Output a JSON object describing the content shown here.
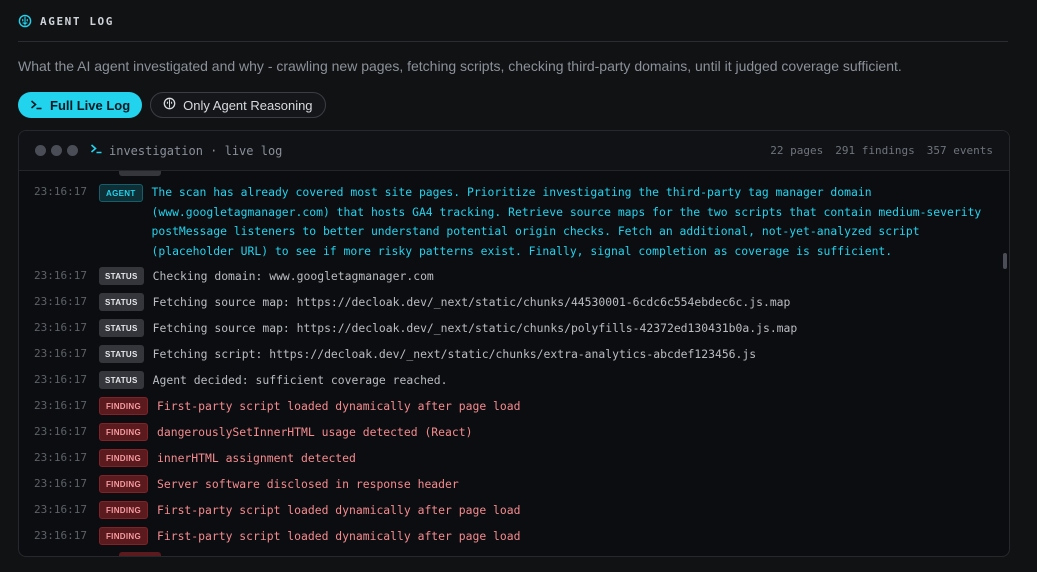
{
  "header": {
    "title": "AGENT LOG",
    "description": "What the AI agent investigated and why - crawling new pages, fetching scripts, checking third-party domains, until it judged coverage sufficient."
  },
  "tabs": [
    {
      "label": "Full Live Log",
      "icon": "terminal-prompt-icon",
      "active": true
    },
    {
      "label": "Only Agent Reasoning",
      "icon": "brain-icon",
      "active": false
    }
  ],
  "terminal": {
    "title": "investigation · live log",
    "stats": {
      "pages": "22 pages",
      "findings": "291 findings",
      "events": "357 events"
    }
  },
  "colors": {
    "accent": "#22d3ee",
    "finding": "#f38b8f",
    "status_badge": "#34363b",
    "finding_badge": "#5b1a1d"
  },
  "log": [
    {
      "time": "23:16:17",
      "badge": "AGENT",
      "type": "agent",
      "text": "The scan has already covered most site pages. Prioritize investigating the third-party tag manager domain (www.googletagmanager.com) that hosts GA4 tracking. Retrieve source maps for the two scripts that contain medium-severity postMessage listeners to better understand potential origin checks. Fetch an additional, not-yet-analyzed script (placeholder URL) to see if more risky patterns exist. Finally, signal completion as coverage is sufficient."
    },
    {
      "time": "23:16:17",
      "badge": "STATUS",
      "type": "status",
      "text": "Checking domain: www.googletagmanager.com"
    },
    {
      "time": "23:16:17",
      "badge": "STATUS",
      "type": "status",
      "text": "Fetching source map: https://decloak.dev/_next/static/chunks/44530001-6cdc6c554ebdec6c.js.map"
    },
    {
      "time": "23:16:17",
      "badge": "STATUS",
      "type": "status",
      "text": "Fetching source map: https://decloak.dev/_next/static/chunks/polyfills-42372ed130431b0a.js.map"
    },
    {
      "time": "23:16:17",
      "badge": "STATUS",
      "type": "status",
      "text": "Fetching script: https://decloak.dev/_next/static/chunks/extra-analytics-abcdef123456.js"
    },
    {
      "time": "23:16:17",
      "badge": "STATUS",
      "type": "status",
      "text": "Agent decided: sufficient coverage reached."
    },
    {
      "time": "23:16:17",
      "badge": "FINDING",
      "type": "finding",
      "text": "First-party script loaded dynamically after page load"
    },
    {
      "time": "23:16:17",
      "badge": "FINDING",
      "type": "finding",
      "text": "dangerouslySetInnerHTML usage detected (React)"
    },
    {
      "time": "23:16:17",
      "badge": "FINDING",
      "type": "finding",
      "text": "innerHTML assignment detected"
    },
    {
      "time": "23:16:17",
      "badge": "FINDING",
      "type": "finding",
      "text": "Server software disclosed in response header"
    },
    {
      "time": "23:16:17",
      "badge": "FINDING",
      "type": "finding",
      "text": "First-party script loaded dynamically after page load"
    },
    {
      "time": "23:16:17",
      "badge": "FINDING",
      "type": "finding",
      "text": "First-party script loaded dynamically after page load"
    }
  ]
}
